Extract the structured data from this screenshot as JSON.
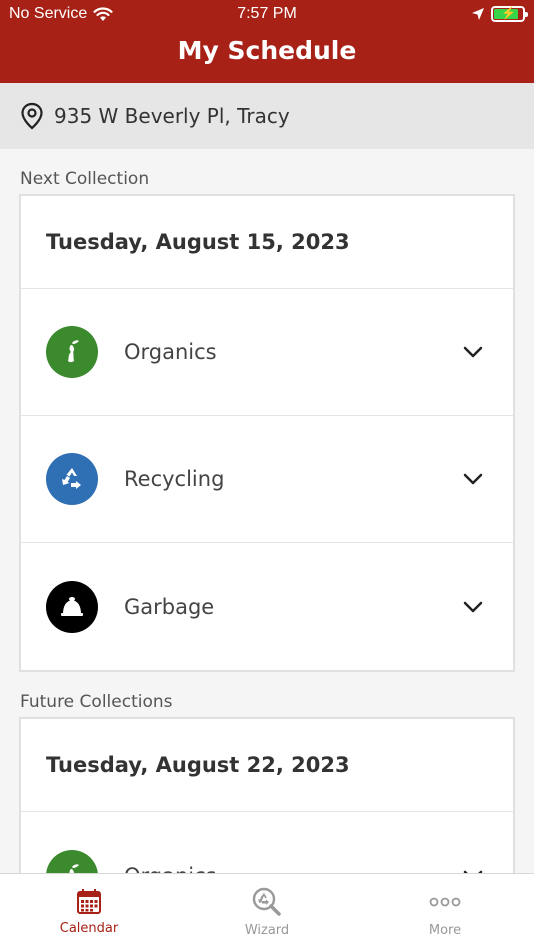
{
  "status_bar": {
    "carrier": "No Service",
    "time": "7:57 PM"
  },
  "header": {
    "title": "My Schedule"
  },
  "address": {
    "text": "935 W Beverly Pl, Tracy"
  },
  "next": {
    "label": "Next Collection",
    "date": "Tuesday, August 15, 2023",
    "items": [
      {
        "label": "Organics",
        "icon": "organics-icon",
        "color": "#3c8a2e"
      },
      {
        "label": "Recycling",
        "icon": "recycling-icon",
        "color": "#2f6fb3"
      },
      {
        "label": "Garbage",
        "icon": "garbage-icon",
        "color": "#000000"
      }
    ]
  },
  "future": {
    "label": "Future Collections",
    "date": "Tuesday, August 22, 2023",
    "items": [
      {
        "label": "Organics",
        "icon": "organics-icon",
        "color": "#3c8a2e"
      }
    ]
  },
  "tabs": [
    {
      "label": "Calendar",
      "icon": "calendar-icon",
      "active": true
    },
    {
      "label": "Wizard",
      "icon": "wizard-icon",
      "active": false
    },
    {
      "label": "More",
      "icon": "more-icon",
      "active": false
    }
  ],
  "colors": {
    "brand": "#a72116",
    "battery": "#37d64a"
  }
}
